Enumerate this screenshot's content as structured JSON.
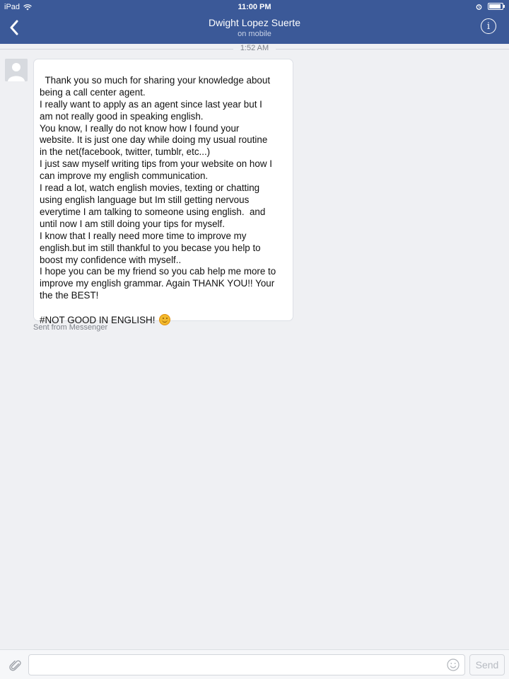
{
  "status_bar": {
    "device": "iPad",
    "time": "11:00 PM",
    "battery_level": 0.9
  },
  "header": {
    "title": "Dwight Lopez Suerte",
    "subtitle": "on mobile"
  },
  "conversation": {
    "timestamp": "1:52 AM",
    "message": {
      "lines": [
        "Thank you so much for sharing your knowledge about",
        "being a call center agent.",
        "I really want to apply as an agent since last year but I",
        "am not really good in speaking english.",
        "You know, I really do not know how I found your",
        "website. It is just one day while doing my usual routine",
        "in the net(facebook, twitter, tumblr, etc...)",
        "I just saw myself writing tips from your website on how I",
        "can improve my english communication.",
        "I read a lot, watch english movies, texting or chatting",
        "using english language but Im still getting nervous",
        "everytime I am talking to someone using english.  and",
        "until now I am still doing your tips for myself.",
        "I know that I really need more time to improve my",
        "english.but im still thankful to you becase you help to",
        "boost my confidence with myself..",
        "I hope you can be my friend so you cab help me more to",
        "improve my english grammar. Again THANK YOU!! Your",
        "the the BEST!",
        "",
        "#NOT GOOD IN ENGLISH!"
      ],
      "emoji": "smiling-face-icon",
      "footer": "Sent from Messenger"
    }
  },
  "composer": {
    "placeholder": "",
    "send_label": "Send"
  },
  "colors": {
    "header_bg": "#3b5998",
    "page_bg": "#eff0f3",
    "muted_text": "#7f838b"
  }
}
